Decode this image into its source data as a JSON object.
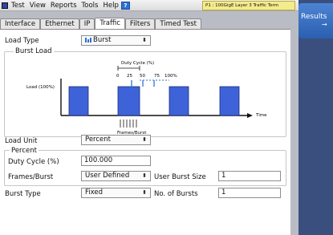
{
  "menubar": {
    "items": [
      "Test",
      "View",
      "Reports",
      "Tools",
      "Help"
    ],
    "port_banner": "P1 : 100GigE Layer 3 Traffic Term"
  },
  "results_tab": {
    "label": "Results"
  },
  "tabs": [
    "Interface",
    "Ethernet",
    "IP",
    "Traffic",
    "Filters",
    "Timed Test"
  ],
  "active_tab": "Traffic",
  "load_type": {
    "label": "Load Type",
    "value": "Burst"
  },
  "burst_load": {
    "title": "Burst Load",
    "diagram": {
      "duty_cycle_label": "Duty Cycle (%)",
      "duty_ticks": [
        "0",
        "25",
        "50",
        "75",
        "100%"
      ],
      "load_label": "Load (100%)",
      "frames_label": "Frames/Burst",
      "time_label": "Time"
    }
  },
  "load_unit": {
    "label": "Load Unit",
    "value": "Percent"
  },
  "percent_group": {
    "title": "Percent",
    "duty_cycle_label": "Duty Cycle (%)",
    "duty_cycle_value": "100.000",
    "frames_burst_label": "Frames/Burst",
    "frames_burst_value": "User Defined",
    "user_burst_size_label": "User Burst Size",
    "user_burst_size_value": "1"
  },
  "burst_type": {
    "label": "Burst Type",
    "value": "Fixed"
  },
  "num_bursts": {
    "label": "No. of Bursts",
    "value": "1"
  },
  "colors": {
    "accent": "#2f6fd6",
    "burst_fill": "#3e63d8",
    "banner": "#f4eb8c",
    "results_panel": "#3b4f7f"
  }
}
